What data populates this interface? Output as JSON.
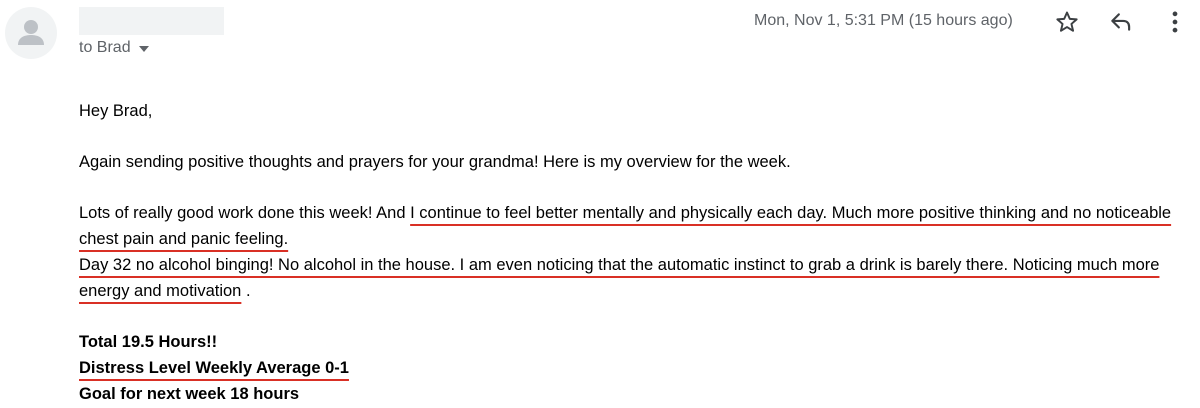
{
  "header": {
    "recipient_line": "to Brad",
    "date": "Mon, Nov 1, 5:31 PM (15 hours ago)",
    "icons": {
      "avatar": "person-icon",
      "recipients_toggle": "chevron-down-icon",
      "star": "star-icon",
      "reply": "reply-icon",
      "more": "more-vert-icon"
    }
  },
  "message": {
    "greeting": "Hey Brad,",
    "para1": "Again sending positive thoughts and prayers for your grandma! Here is my overview for the week.",
    "para2_intro": "Lots of really good work done this week! And ",
    "para2_highlight": "I continue to feel better mentally and physically each day. Much more positive thinking and no noticeable chest pain and panic feeling.",
    "para3_highlight": "Day 32 no alcohol binging! No alcohol in the house. I am even noticing that the automatic instinct to grab a drink is barely there. Noticing much more energy and motivation",
    "para3_end": " .",
    "total": "Total 19.5 Hours!!",
    "distress": "Distress Level Weekly Average 0-1",
    "goal": "Goal for next week 18 hours"
  },
  "colors": {
    "underline": "#d93025",
    "meta_text": "#5f6368",
    "avatar_bg": "#f1f3f4"
  }
}
